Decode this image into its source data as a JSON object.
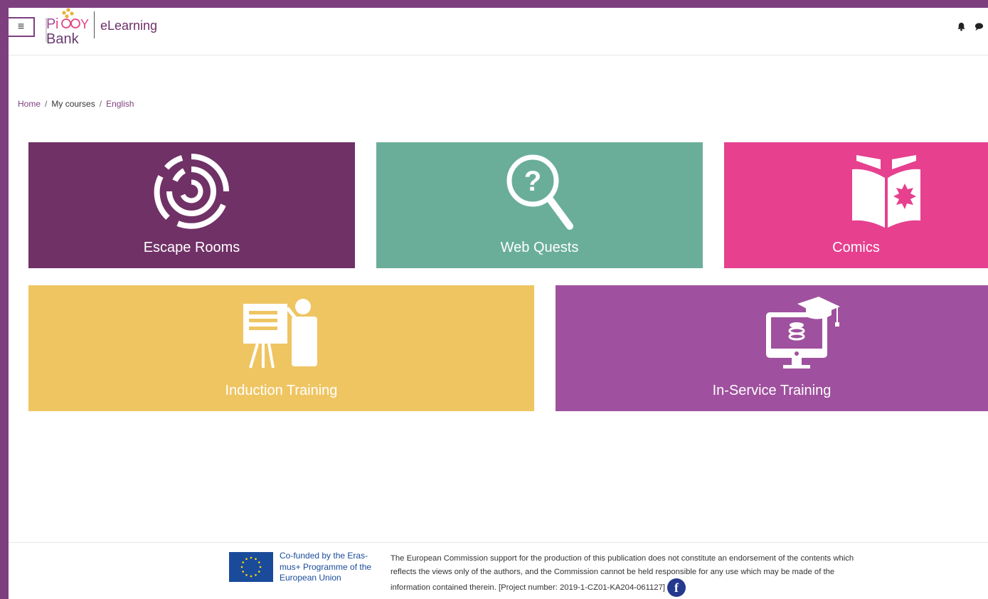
{
  "header": {
    "menu_icon": "hamburger-icon",
    "logo_text_top": "PIGGY",
    "logo_text_bottom": "Bank",
    "site_name": "eLearning",
    "icons": [
      "bell-icon",
      "chat-icon"
    ]
  },
  "breadcrumb": {
    "items": [
      "Home",
      "My courses",
      "English"
    ],
    "separator": "/"
  },
  "tiles": [
    {
      "label": "Escape Rooms",
      "icon": "maze-icon",
      "color": "#703166"
    },
    {
      "label": "Web Quests",
      "icon": "magnifier-question-icon",
      "color": "#6aae9a"
    },
    {
      "label": "Comics",
      "icon": "open-book-icon",
      "color": "#e6408f"
    },
    {
      "label": "Induction Training",
      "icon": "presenter-icon",
      "color": "#efc562"
    },
    {
      "label": "In-Service Training",
      "icon": "monitor-graduation-icon",
      "color": "#9f509e"
    }
  ],
  "footer": {
    "eu_text": "Co-funded by the Eras-mus+ Programme of the European Union",
    "disclaimer": "The European Commission support for the production of this publication does not constitute an endorsement of the contents which reflects the views only of the authors, and the Commission cannot be held responsible for any use which may be made of the information contained therein. [Project number: 2019-1-CZ01-KA204-061127]",
    "facebook_icon": "facebook-icon",
    "eu_flag_color": "#1a4b9b"
  }
}
